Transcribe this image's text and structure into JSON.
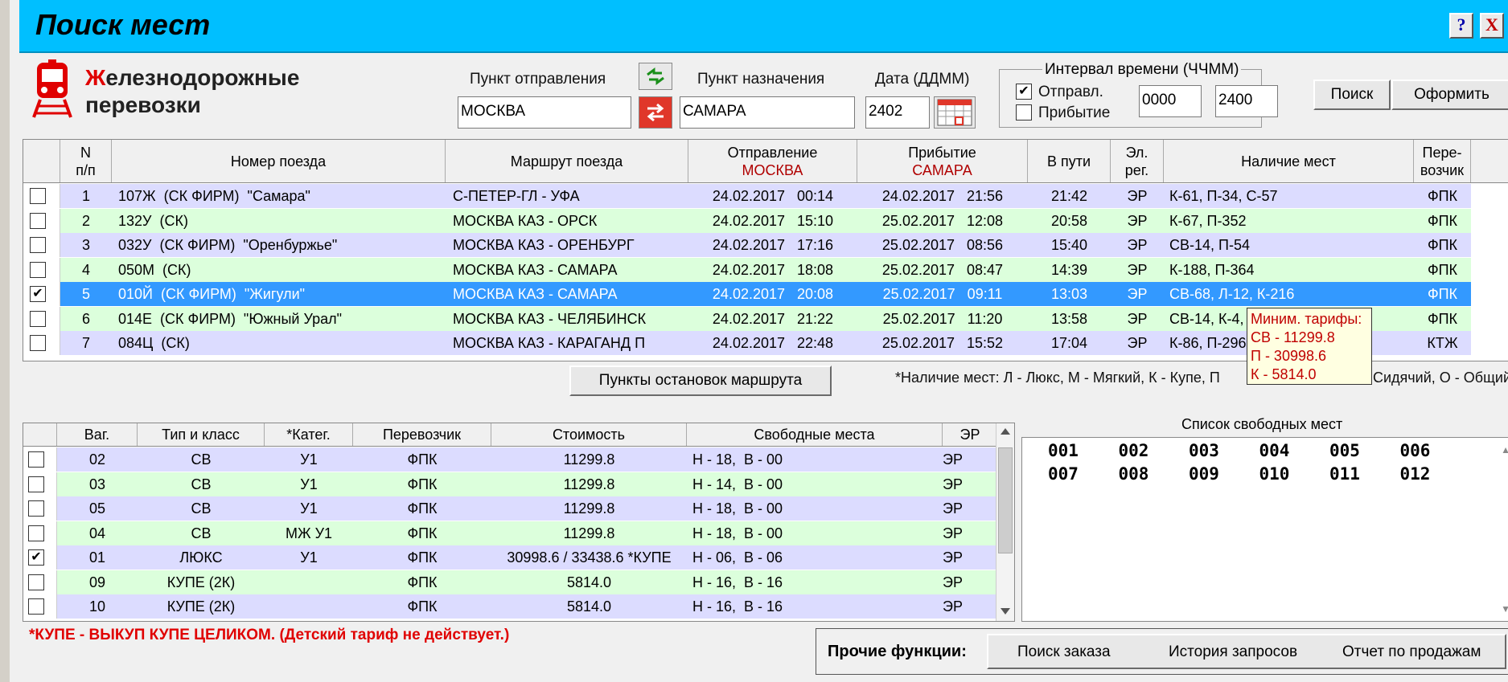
{
  "window": {
    "title": "Поиск мест",
    "help_label": "?",
    "close_label": "X"
  },
  "logo": {
    "line1_first": "Ж",
    "line1_rest": "елезнодорожные",
    "line2": "перевозки",
    "icon": "train-icon"
  },
  "form": {
    "from_label": "Пункт отправления",
    "from_value": "МОСКВА",
    "to_label": "Пункт назначения",
    "to_value": "САМАРА",
    "date_label": "Дата (ДДММ)",
    "date_value": "2402",
    "interval_label": "Интервал времени (ЧЧММ)",
    "departure_label": "Отправл.",
    "departure_checked": true,
    "arrival_label": "Прибытие",
    "arrival_checked": false,
    "time_from": "0000",
    "time_to": "2400",
    "search_button": "Поиск",
    "issue_button": "Оформить"
  },
  "trains": {
    "headers": {
      "num": "N",
      "num2": "п/п",
      "train": "Номер поезда",
      "route": "Маршрут поезда",
      "dep": "Отправление",
      "dep_sub": "МОСКВА",
      "arr": "Прибытие",
      "arr_sub": "САМАРА",
      "travel": "В пути",
      "el": "Эл.",
      "el2": "рег.",
      "avail": "Наличие мест",
      "carrier": "Пере-",
      "carrier2": "возчик"
    },
    "rows": [
      {
        "checked": false,
        "n": "1",
        "train": "107Ж  (СК ФИРМ)  \"Самара\"",
        "route": "С-ПЕТЕР-ГЛ - УФА",
        "dep": "24.02.2017   00:14",
        "arr": "24.02.2017   21:56",
        "travel": "21:42",
        "el": "ЭР",
        "avail": "К-61, П-34, С-57",
        "carrier": "ФПК"
      },
      {
        "checked": false,
        "n": "2",
        "train": "132У  (СК)",
        "route": "МОСКВА КАЗ - ОРСК",
        "dep": "24.02.2017   15:10",
        "arr": "25.02.2017   12:08",
        "travel": "20:58",
        "el": "ЭР",
        "avail": "К-67, П-352",
        "carrier": "ФПК"
      },
      {
        "checked": false,
        "n": "3",
        "train": "032У  (СК ФИРМ)  \"Оренбуржье\"",
        "route": "МОСКВА КАЗ - ОРЕНБУРГ",
        "dep": "24.02.2017   17:16",
        "arr": "25.02.2017   08:56",
        "travel": "15:40",
        "el": "ЭР",
        "avail": "СВ-14, П-54",
        "carrier": "ФПК"
      },
      {
        "checked": false,
        "n": "4",
        "train": "050М  (СК)",
        "route": "МОСКВА КАЗ - САМАРА",
        "dep": "24.02.2017   18:08",
        "arr": "25.02.2017   08:47",
        "travel": "14:39",
        "el": "ЭР",
        "avail": "К-188, П-364",
        "carrier": "ФПК"
      },
      {
        "checked": true,
        "n": "5",
        "train": "010Й  (СК ФИРМ)  \"Жигули\"",
        "route": "МОСКВА КАЗ - САМАРА",
        "dep": "24.02.2017   20:08",
        "arr": "25.02.2017   09:11",
        "travel": "13:03",
        "el": "ЭР",
        "avail": "СВ-68, Л-12, К-216",
        "carrier": "ФПК"
      },
      {
        "checked": false,
        "n": "6",
        "train": "014Е  (СК ФИРМ)  \"Южный Урал\"",
        "route": "МОСКВА КАЗ - ЧЕЛЯБИНСК",
        "dep": "24.02.2017   21:22",
        "arr": "25.02.2017   11:20",
        "travel": "13:58",
        "el": "ЭР",
        "avail": "СВ-14, К-4,",
        "carrier": "ФПК"
      },
      {
        "checked": false,
        "n": "7",
        "train": "084Ц  (СК)",
        "route": "МОСКВА КАЗ - КАРАГАНД П",
        "dep": "24.02.2017   22:48",
        "arr": "25.02.2017   15:52",
        "travel": "17:04",
        "el": "ЭР",
        "avail": "К-86, П-296",
        "carrier": "КТЖ"
      }
    ]
  },
  "tooltip": {
    "title": "Миним. тарифы:",
    "lines": [
      "СВ - 11299.8",
      "П - 30998.6",
      "К - 5814.0"
    ]
  },
  "stops_button": "Пункты остановок маршрута",
  "legend_text": "*Наличие мест:  Л - Люкс, М - Мягкий, К - Купе, П",
  "legend_tail": "Сидячий, О - Общий",
  "cars": {
    "headers": {
      "car": "Ваг.",
      "type": "Тип и класс",
      "cat": "*Катег.",
      "carrier": "Перевозчик",
      "price": "Стоимость",
      "free": "Свободные места",
      "er": "ЭР"
    },
    "rows": [
      {
        "checked": false,
        "car": "02",
        "type": "СВ",
        "cat": "У1",
        "carrier": "ФПК",
        "price": "11299.8",
        "free": "Н - 18,  В - 00",
        "er": "ЭР"
      },
      {
        "checked": false,
        "car": "03",
        "type": "СВ",
        "cat": "У1",
        "carrier": "ФПК",
        "price": "11299.8",
        "free": "Н - 14,  В - 00",
        "er": "ЭР"
      },
      {
        "checked": false,
        "car": "05",
        "type": "СВ",
        "cat": "У1",
        "carrier": "ФПК",
        "price": "11299.8",
        "free": "Н - 18,  В - 00",
        "er": "ЭР"
      },
      {
        "checked": false,
        "car": "04",
        "type": "СВ",
        "cat": "МЖ У1",
        "carrier": "ФПК",
        "price": "11299.8",
        "free": "Н - 18,  В - 00",
        "er": "ЭР"
      },
      {
        "checked": true,
        "car": "01",
        "type": "ЛЮКС",
        "cat": "У1",
        "carrier": "ФПК",
        "price": "30998.6 / 33438.6 *КУПЕ",
        "free": "Н - 06,  В - 06",
        "er": "ЭР"
      },
      {
        "checked": false,
        "car": "09",
        "type": "КУПЕ (2К)",
        "cat": "",
        "carrier": "ФПК",
        "price": "5814.0",
        "free": "Н - 16,  В - 16",
        "er": "ЭР"
      },
      {
        "checked": false,
        "car": "10",
        "type": "КУПЕ (2К)",
        "cat": "",
        "carrier": "ФПК",
        "price": "5814.0",
        "free": "Н - 16,  В - 16",
        "er": "ЭР"
      }
    ]
  },
  "seats": {
    "label": "Список свободных мест",
    "rows": [
      [
        "001",
        "002",
        "003",
        "004",
        "005",
        "006"
      ],
      [
        "007",
        "008",
        "009",
        "010",
        "011",
        "012"
      ]
    ]
  },
  "note": "*КУПЕ - ВЫКУП КУПЕ ЦЕЛИКОМ. (Детский тариф не действует.)",
  "other": {
    "label": "Прочие функции:",
    "buttons": [
      "Поиск заказа",
      "История запросов",
      "Отчет по продажам"
    ]
  },
  "colors": {
    "titlebar": "#00bfff",
    "row_odd": "#dcdcff",
    "row_even": "#dcffdc",
    "row_selected": "#3399ff",
    "accent_red": "#e00000"
  }
}
